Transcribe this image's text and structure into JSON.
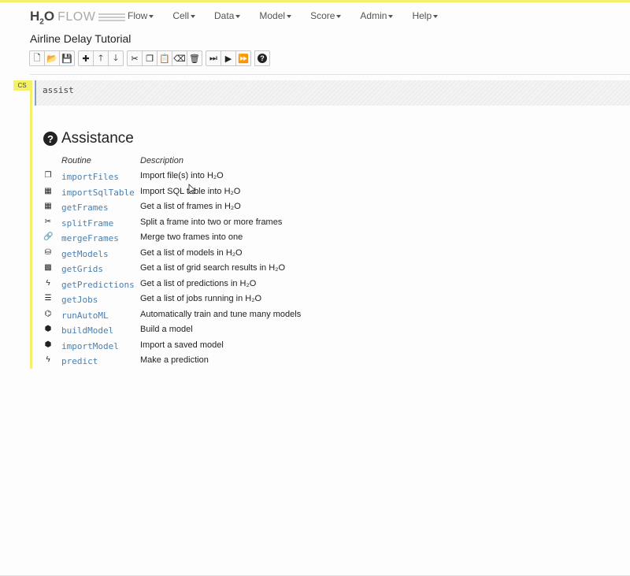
{
  "app": {
    "logo_prefix": "H",
    "logo_sub": "2",
    "logo_suffix": "O",
    "logo_flow": "FLOW"
  },
  "menu": [
    {
      "label": "Flow"
    },
    {
      "label": "Cell"
    },
    {
      "label": "Data"
    },
    {
      "label": "Model"
    },
    {
      "label": "Score"
    },
    {
      "label": "Admin"
    },
    {
      "label": "Help"
    }
  ],
  "notebook_title": "Airline Delay Tutorial",
  "toolbar_groups": [
    [
      {
        "name": "new-notebook",
        "glyph": "🗋"
      },
      {
        "name": "open-notebook",
        "glyph": "📂"
      },
      {
        "name": "save-notebook",
        "glyph": "💾"
      }
    ],
    [
      {
        "name": "insert-cell",
        "glyph": "✚"
      },
      {
        "name": "move-up",
        "glyph": "🡑"
      },
      {
        "name": "move-down",
        "glyph": "🡓"
      }
    ],
    [
      {
        "name": "cut-cell",
        "glyph": "✂"
      },
      {
        "name": "copy-cell",
        "glyph": "❐"
      },
      {
        "name": "paste-cell",
        "glyph": "📋"
      },
      {
        "name": "clear-cell",
        "glyph": "⌫"
      },
      {
        "name": "delete-cell",
        "glyph": "🗑"
      }
    ],
    [
      {
        "name": "run-step",
        "glyph": "⏭"
      },
      {
        "name": "run-cell",
        "glyph": "▶"
      },
      {
        "name": "run-all",
        "glyph": "⏩"
      }
    ],
    [
      {
        "name": "help",
        "glyph": "?"
      }
    ]
  ],
  "cell": {
    "type_badge": "CS",
    "code": "assist"
  },
  "assistance": {
    "title": "Assistance",
    "col_routine": "Routine",
    "col_description": "Description",
    "rows": [
      {
        "icon": "copy-icon",
        "glyph": "❐",
        "routine": "importFiles",
        "description": "Import file(s) into H₂O"
      },
      {
        "icon": "table-icon",
        "glyph": "▦",
        "routine": "importSqlTable",
        "description": "Import SQL table into H₂O"
      },
      {
        "icon": "table-icon",
        "glyph": "▦",
        "routine": "getFrames",
        "description": "Get a list of frames in H₂O"
      },
      {
        "icon": "scissors-icon",
        "glyph": "✂",
        "routine": "splitFrame",
        "description": "Split a frame into two or more frames"
      },
      {
        "icon": "link-icon",
        "glyph": "🔗",
        "routine": "mergeFrames",
        "description": "Merge two frames into one"
      },
      {
        "icon": "cubes-icon",
        "glyph": "⛁",
        "routine": "getModels",
        "description": "Get a list of models in H₂O"
      },
      {
        "icon": "grid-icon",
        "glyph": "▩",
        "routine": "getGrids",
        "description": "Get a list of grid search results in H₂O"
      },
      {
        "icon": "bolt-icon",
        "glyph": "ϟ",
        "routine": "getPredictions",
        "description": "Get a list of predictions in H₂O"
      },
      {
        "icon": "list-icon",
        "glyph": "☰",
        "routine": "getJobs",
        "description": "Get a list of jobs running in H₂O"
      },
      {
        "icon": "sitemap-icon",
        "glyph": "⌬",
        "routine": "runAutoML",
        "description": "Automatically train and tune many models"
      },
      {
        "icon": "cube-icon",
        "glyph": "⬢",
        "routine": "buildModel",
        "description": "Build a model"
      },
      {
        "icon": "cube-icon",
        "glyph": "⬢",
        "routine": "importModel",
        "description": "Import a saved model"
      },
      {
        "icon": "bolt-icon",
        "glyph": "ϟ",
        "routine": "predict",
        "description": "Make a prediction"
      }
    ]
  }
}
